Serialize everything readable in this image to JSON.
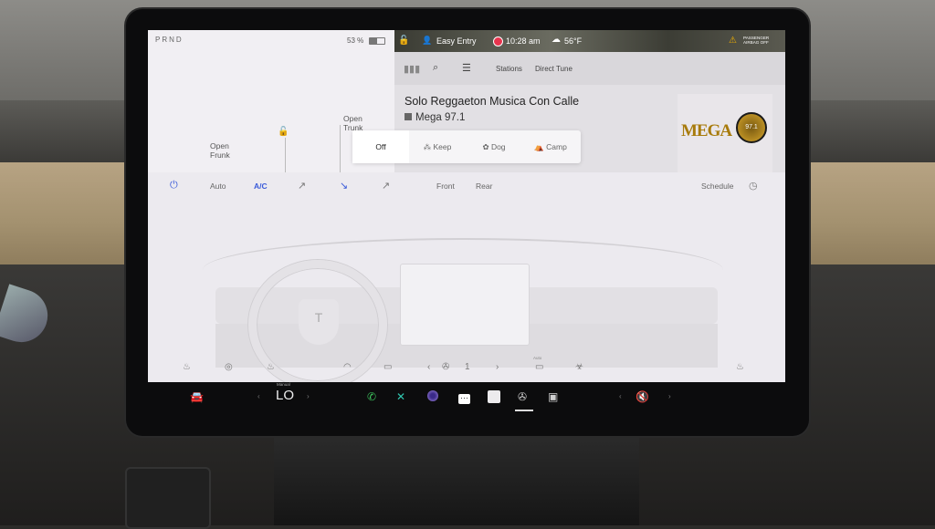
{
  "car": {
    "gear": "PRND",
    "battery_percent": "53 %",
    "battery_level": 0.53,
    "frunk": {
      "line1": "Open",
      "line2": "Frunk"
    },
    "trunk": {
      "line1": "Open",
      "line2": "Trunk"
    }
  },
  "status": {
    "profile": "Easy Entry",
    "time": "10:28 am",
    "temperature": "56°F",
    "airbag_line1": "PASSENGER",
    "airbag_line2": "AIRBAG OFF",
    "icons": [
      "lock-icon",
      "user-icon",
      "record-icon",
      "weather-icon",
      "airbag-icon"
    ]
  },
  "media": {
    "tabs": {
      "stations": "Stations",
      "direct_tune": "Direct Tune"
    },
    "song": "Solo Reggaeton Musica Con Calle",
    "station": "Mega 97.1",
    "album_logo": "MEGA",
    "album_badge": "97.1"
  },
  "climate_modes": {
    "off": "Off",
    "keep": "Keep",
    "dog": "Dog",
    "camp": "Camp",
    "selected": "Off"
  },
  "climate": {
    "auto": "Auto",
    "ac": "A/C",
    "front": "Front",
    "rear": "Rear",
    "schedule": "Schedule",
    "fan_speed": "1",
    "bottom_auto": "Auto",
    "accent_color": "#3a5bd9"
  },
  "taskbar": {
    "driver_temp_label": "Manual",
    "driver_temp": "LO",
    "left_arrow": "‹",
    "right_arrow": "›"
  }
}
